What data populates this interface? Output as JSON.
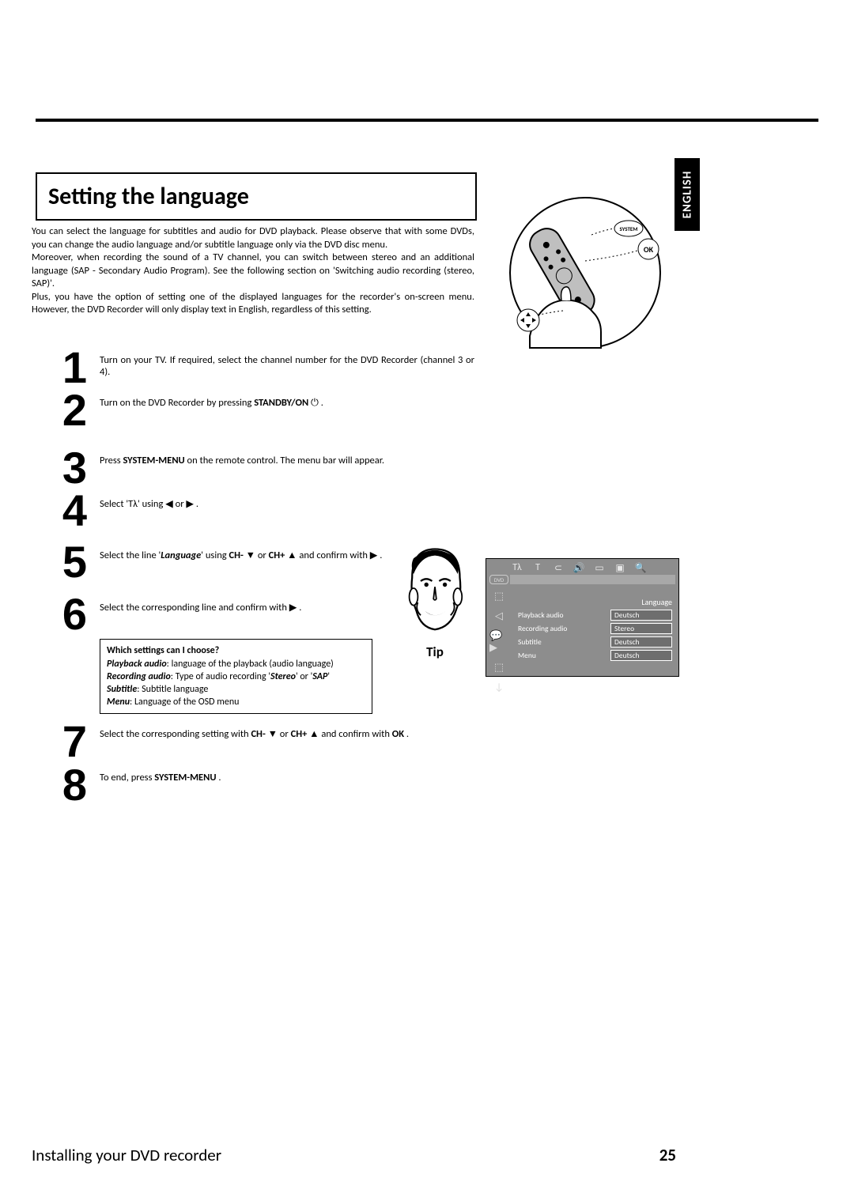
{
  "language_tab": "ENGLISH",
  "title": "Setting the language",
  "intro": {
    "p1": "You can select the language for subtitles and audio for DVD playback. Please observe that with some DVDs, you can change the audio language and/or subtitle language only via the DVD disc menu.",
    "p2": "Moreover, when recording the sound of a TV channel, you can switch between stereo and an additional language (SAP - Secondary Audio Program). See the following section on 'Switching audio recording (stereo, SAP)'.",
    "p3": "Plus, you have the option of setting one of the displayed languages for the recorder's on-screen menu. However, the DVD Recorder will only display text in English, regardless of this setting."
  },
  "steps": {
    "s1": {
      "num": "1",
      "text_a": "Turn on your TV. If required, select the channel number for the DVD Recorder (channel 3 or 4)."
    },
    "s2": {
      "num": "2",
      "text_a": "Turn on the DVD Recorder by pressing ",
      "kw": "STANDBY/ON",
      "text_b": " ⏻ ."
    },
    "s3": {
      "num": "3",
      "text_a": "Press ",
      "kw": "SYSTEM-MENU",
      "text_b": " on the remote control. The menu bar will appear."
    },
    "s4": {
      "num": "4",
      "text_a": "Select '",
      "icon": "Tλ",
      "text_b": "' using ◀ or ▶ ."
    },
    "s5": {
      "num": "5",
      "text_a": "Select the line '",
      "kw_em": "Language",
      "text_b": "' using ",
      "kw2": "CH-",
      "sym2": " ▼ or ",
      "kw3": "CH+",
      "sym3": " ▲ and confirm with ▶ ."
    },
    "s6": {
      "num": "6",
      "text_a": "Select the corresponding line and confirm with ▶ ."
    },
    "s7": {
      "num": "7",
      "text_a": "Select the corresponding setting with ",
      "kw2": "CH-",
      "sym2": " ▼ or ",
      "kw3": "CH+",
      "sym3": " ▲ and confirm with ",
      "kw4": "OK",
      "text_b": " ."
    },
    "s8": {
      "num": "8",
      "text_a": "To end, press ",
      "kw": "SYSTEM-MENU",
      "text_b": " ."
    }
  },
  "tipbox": {
    "q": "Which settings can I choose?",
    "l1a": "Playback audio",
    "l1b": ": language of the playback (audio language)",
    "l2a": "Recording audio",
    "l2b": ": Type of audio recording '",
    "l2c": "Stereo",
    "l2d": "' or '",
    "l2e": "SAP",
    "l2f": "'",
    "l3a": "Subtitle",
    "l3b": ": Subtitle language",
    "l4a": "Menu",
    "l4b": ": Language of the OSD menu"
  },
  "tip_label": "Tip",
  "remote": {
    "system_label": "SYSTEM",
    "ok_label": "OK"
  },
  "osd": {
    "dvd": "DVD",
    "heading": "Language",
    "rows": [
      {
        "label": "Playback audio",
        "value": "Deutsch"
      },
      {
        "label": "Recording audio",
        "value": "Stereo"
      },
      {
        "label": "Subtitle",
        "value": "Deutsch"
      },
      {
        "label": "Menu",
        "value": "Deutsch"
      }
    ],
    "top_icon": "Tλ"
  },
  "footer": {
    "section": "Installing your DVD recorder",
    "page": "25"
  }
}
